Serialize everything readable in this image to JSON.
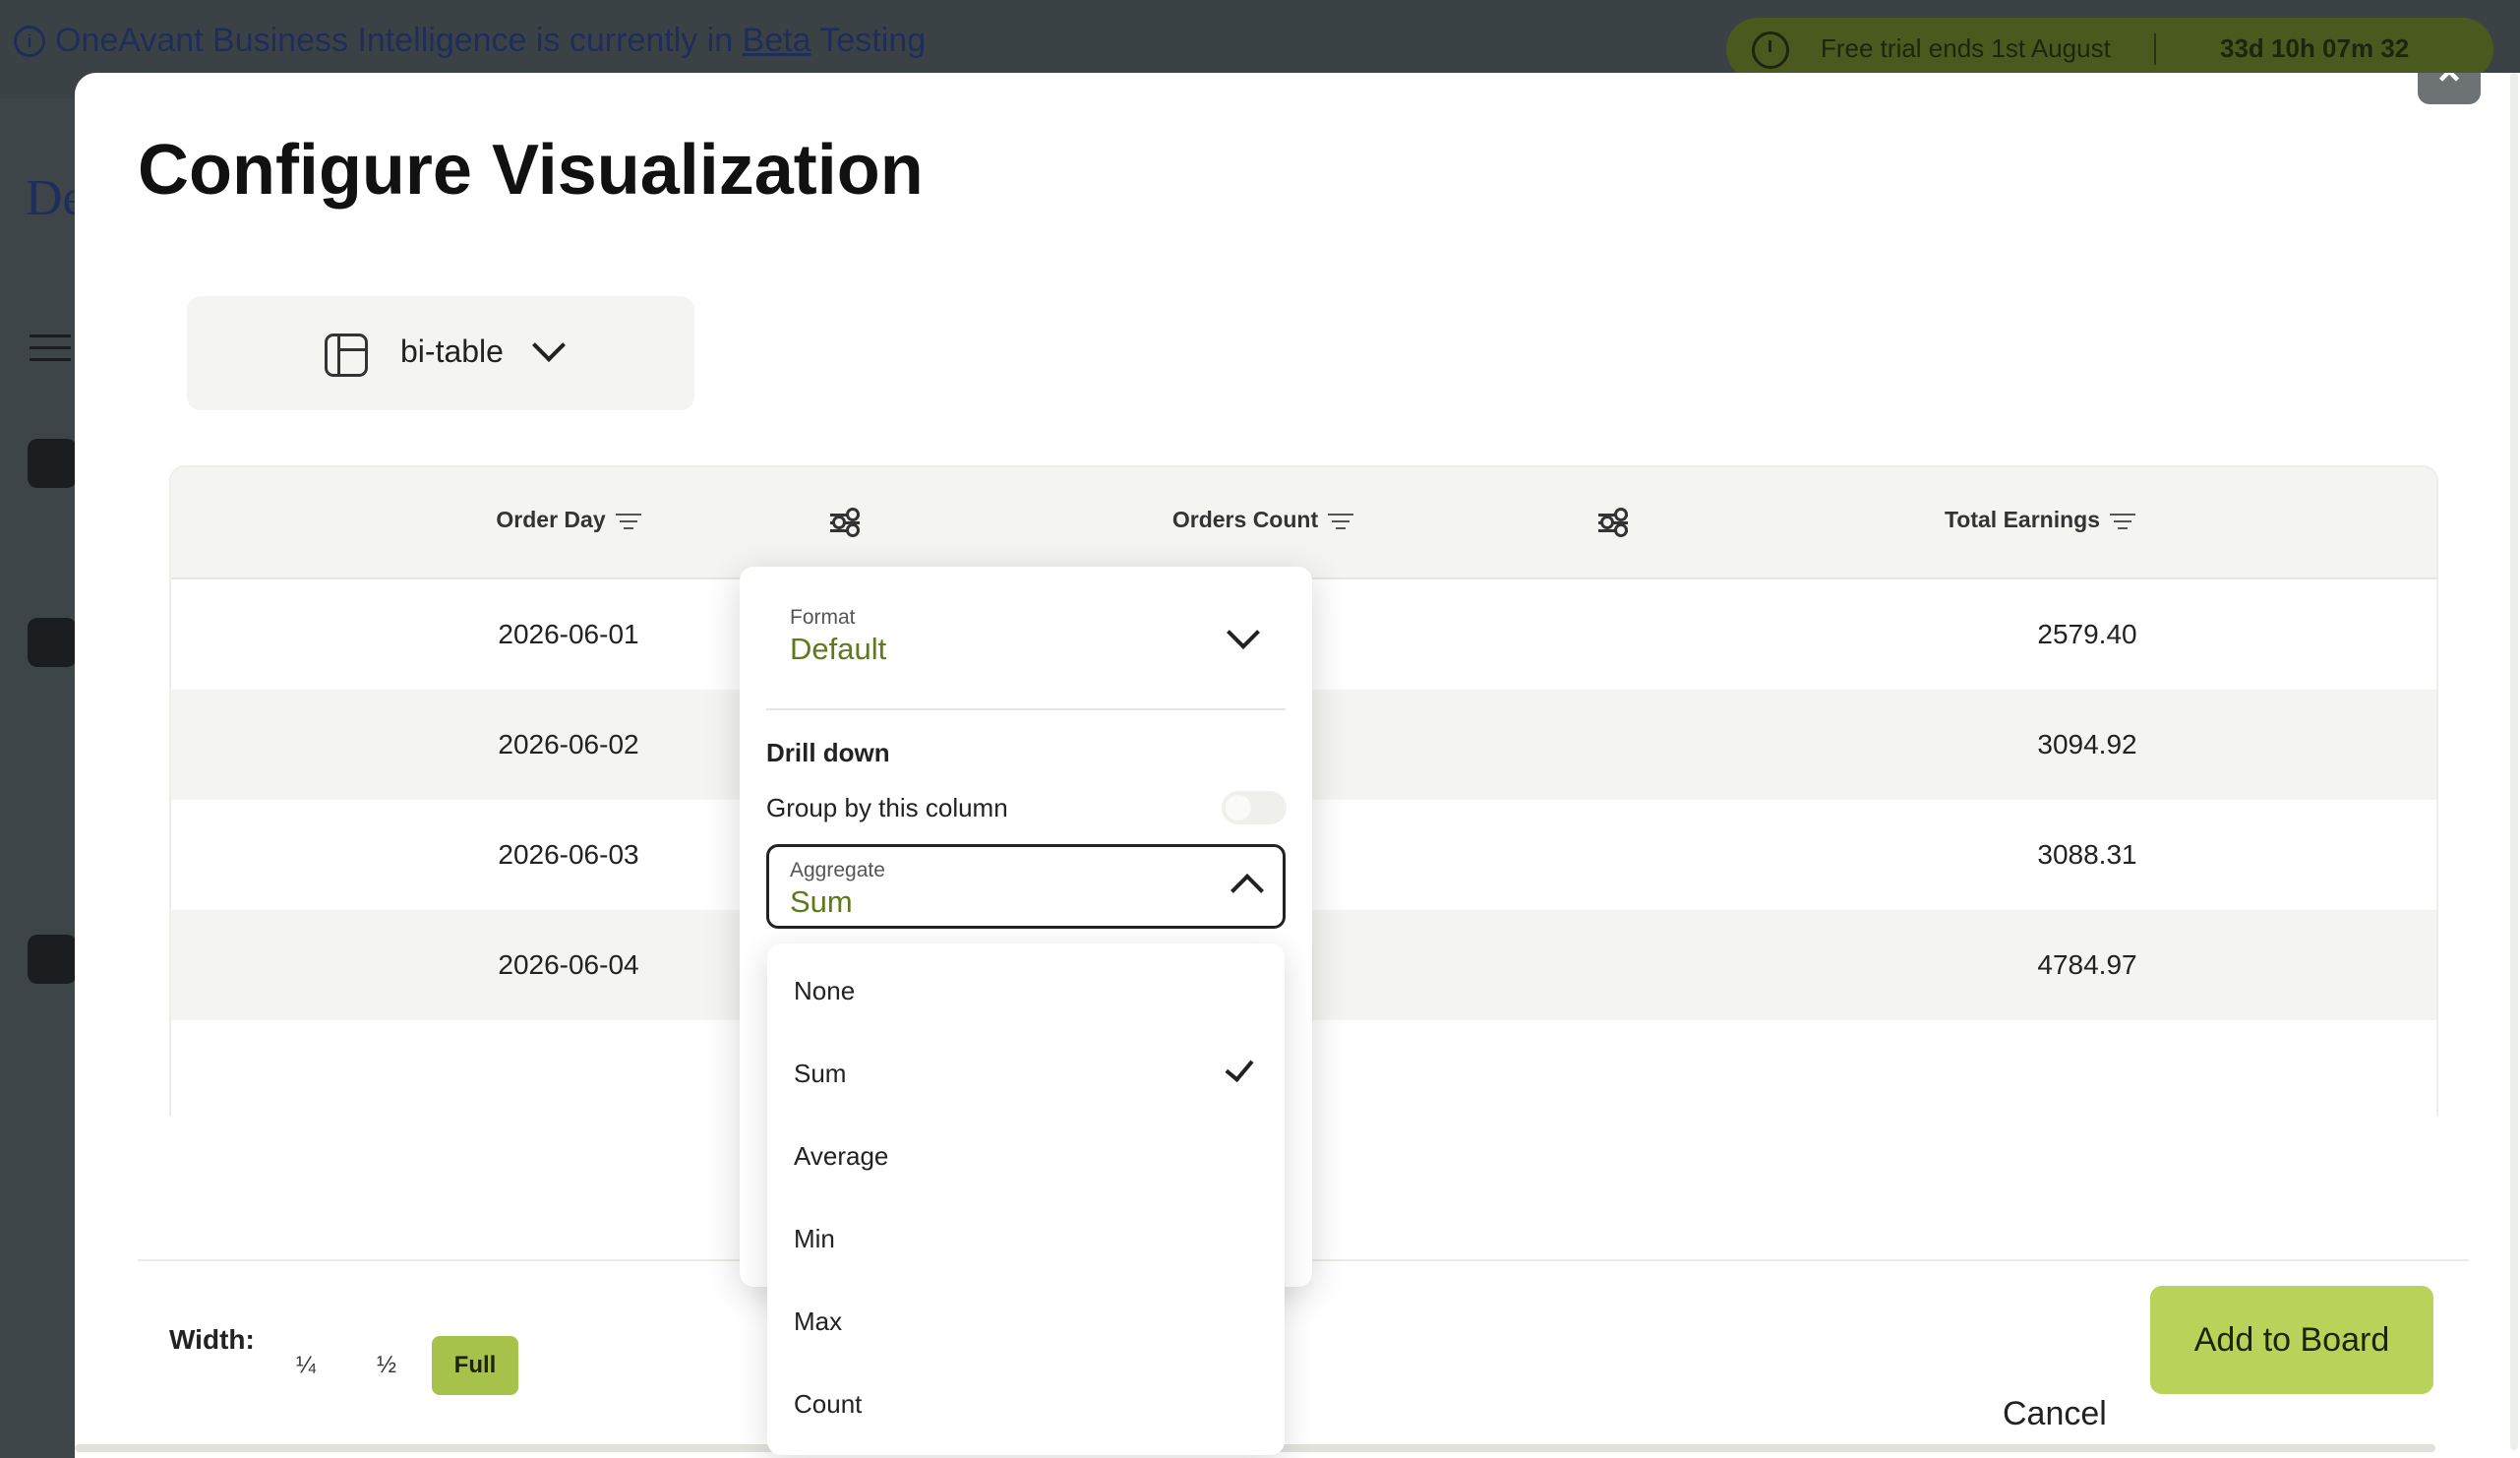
{
  "banner": {
    "prefix": "OneAvant Business Intelligence is currently in ",
    "beta": "Beta",
    "suffix": " Testing",
    "trial_text": "Free trial ends 1st August",
    "countdown": "33d 10h 07m 32"
  },
  "background": {
    "heading_fragment": "De"
  },
  "modal": {
    "title": "Configure Visualization",
    "close_label": "×",
    "viz_type": "bi-table"
  },
  "table": {
    "columns": [
      "Order Day",
      "Orders Count",
      "Total Earnings"
    ],
    "rows": [
      {
        "order_day": "2026-06-01",
        "total_earnings": "2579.40"
      },
      {
        "order_day": "2026-06-02",
        "total_earnings": "3094.92"
      },
      {
        "order_day": "2026-06-03",
        "total_earnings": "3088.31"
      },
      {
        "order_day": "2026-06-04",
        "total_earnings": "4784.97"
      }
    ]
  },
  "column_config": {
    "format_label": "Format",
    "format_value": "Default",
    "drill_down_title": "Drill down",
    "group_by_label": "Group by this column",
    "group_by_enabled": false,
    "aggregate_label": "Aggregate",
    "aggregate_value": "Sum",
    "aggregate_options": [
      "None",
      "Sum",
      "Average",
      "Min",
      "Max",
      "Count"
    ],
    "selected_option": "Sum"
  },
  "footer": {
    "width_label": "Width:",
    "width_options": [
      "¼",
      "½",
      "Full"
    ],
    "width_selected": "Full",
    "cancel_label": "Cancel",
    "add_label": "Add to Board"
  },
  "colors": {
    "accent": "#b8d25a",
    "accent_text": "#5d7a1c"
  }
}
